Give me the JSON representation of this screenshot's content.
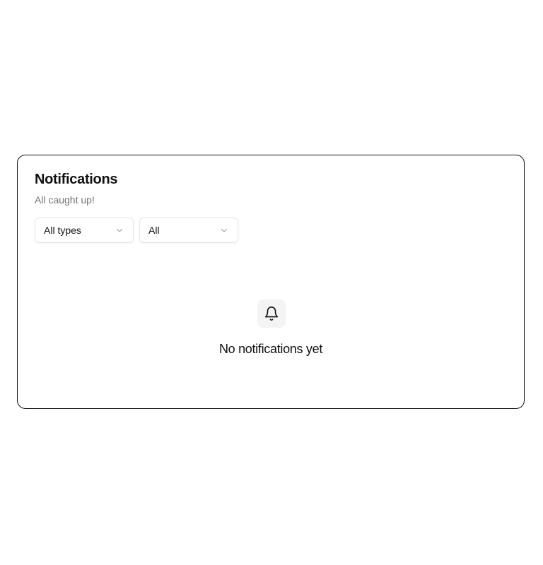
{
  "notifications_panel": {
    "title": "Notifications",
    "subtitle": "All caught up!",
    "filters": {
      "type_select": {
        "value": "All types",
        "icon": "chevron-down-icon"
      },
      "status_select": {
        "value": "All",
        "icon": "chevron-down-icon"
      }
    },
    "empty_state": {
      "icon": "bell-icon",
      "message": "No notifications yet"
    }
  },
  "colors": {
    "border": "#111111",
    "select_border": "#e5e5e5",
    "muted_text": "#737373",
    "icon_bg": "#f4f4f5"
  }
}
